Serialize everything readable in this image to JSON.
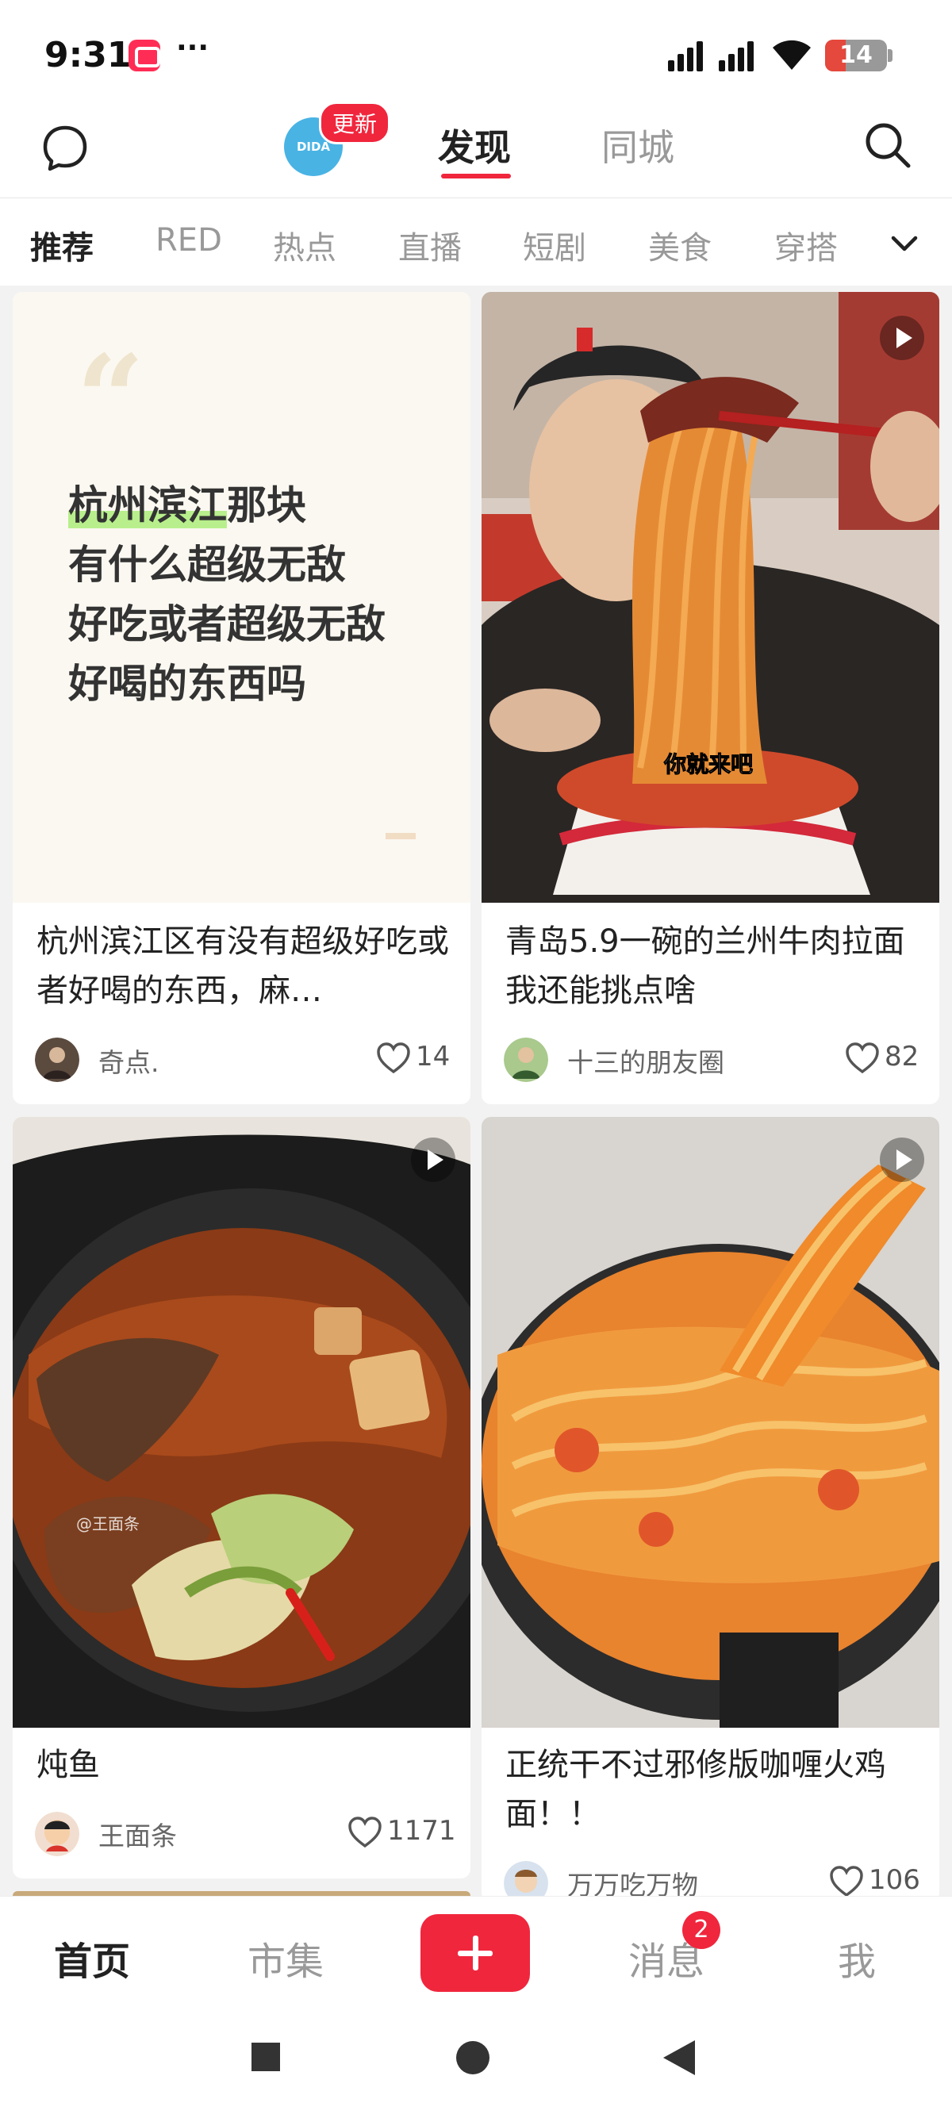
{
  "status_bar": {
    "time": "9:31",
    "more": "···",
    "battery": "14",
    "battery_color": "#e5483c"
  },
  "top_nav": {
    "logo_text": "DIDA",
    "update_badge": "更新",
    "tab_discover": "发现",
    "tab_city": "同城",
    "accent": "#f0263d"
  },
  "categories": [
    "推荐",
    "RED",
    "热点",
    "直播",
    "短剧",
    "美食",
    "穿搭"
  ],
  "quote_card": {
    "line1_highlight": "杭州滨江",
    "line1_rest": "那块",
    "line2": "有什么超级无敌",
    "line3": "好吃或者超级无敌",
    "line4": "好喝的东西吗"
  },
  "feed": [
    {
      "title": "杭州滨江区有没有超级好吃或者好喝的东西，麻…",
      "author": "奇点.",
      "likes": "14",
      "is_video": false
    },
    {
      "title": "青岛5.9一碗的兰州牛肉拉面我还能挑点啥",
      "author": "十三的朋友圈",
      "likes": "82",
      "is_video": true,
      "caption": "你就来吧"
    },
    {
      "title": "炖鱼",
      "author": "王面条",
      "likes": "1171",
      "is_video": true,
      "watermark": "@王面条"
    },
    {
      "title": "正统干不过邪修版咖喱火鸡面！！",
      "author": "万万吃万物",
      "likes": "106",
      "is_video": true
    }
  ],
  "bottom_nav": {
    "home": "首页",
    "market": "市集",
    "messages": "消息",
    "messages_badge": "2",
    "me": "我"
  }
}
